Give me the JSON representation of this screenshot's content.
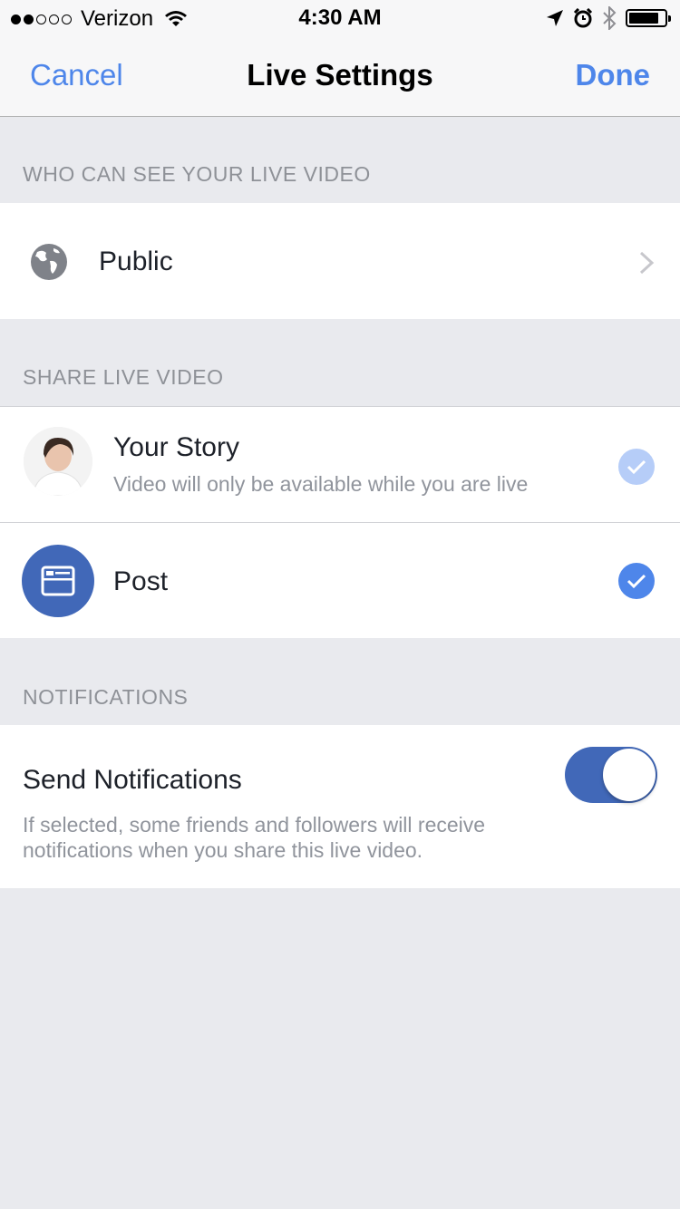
{
  "status_bar": {
    "carrier": "Verizon",
    "time": "4:30 AM",
    "signal_bars_filled": 2,
    "signal_bars_total": 5
  },
  "nav": {
    "cancel_label": "Cancel",
    "title": "Live Settings",
    "done_label": "Done"
  },
  "audience": {
    "header": "WHO CAN SEE YOUR LIVE VIDEO",
    "selected_label": "Public",
    "icon": "globe-icon"
  },
  "share": {
    "header": "SHARE LIVE VIDEO",
    "story": {
      "title": "Your Story",
      "subtitle": "Video will only be available while you are live",
      "checked": true
    },
    "post": {
      "title": "Post",
      "checked": true
    }
  },
  "notifications": {
    "header": "NOTIFICATIONS",
    "title": "Send Notifications",
    "description": "If selected, some friends and followers will receive notifications when you share this live video.",
    "enabled": true
  },
  "colors": {
    "accent": "#4e86ea",
    "toggle_on": "#4168b8",
    "background": "#e9eaee"
  }
}
